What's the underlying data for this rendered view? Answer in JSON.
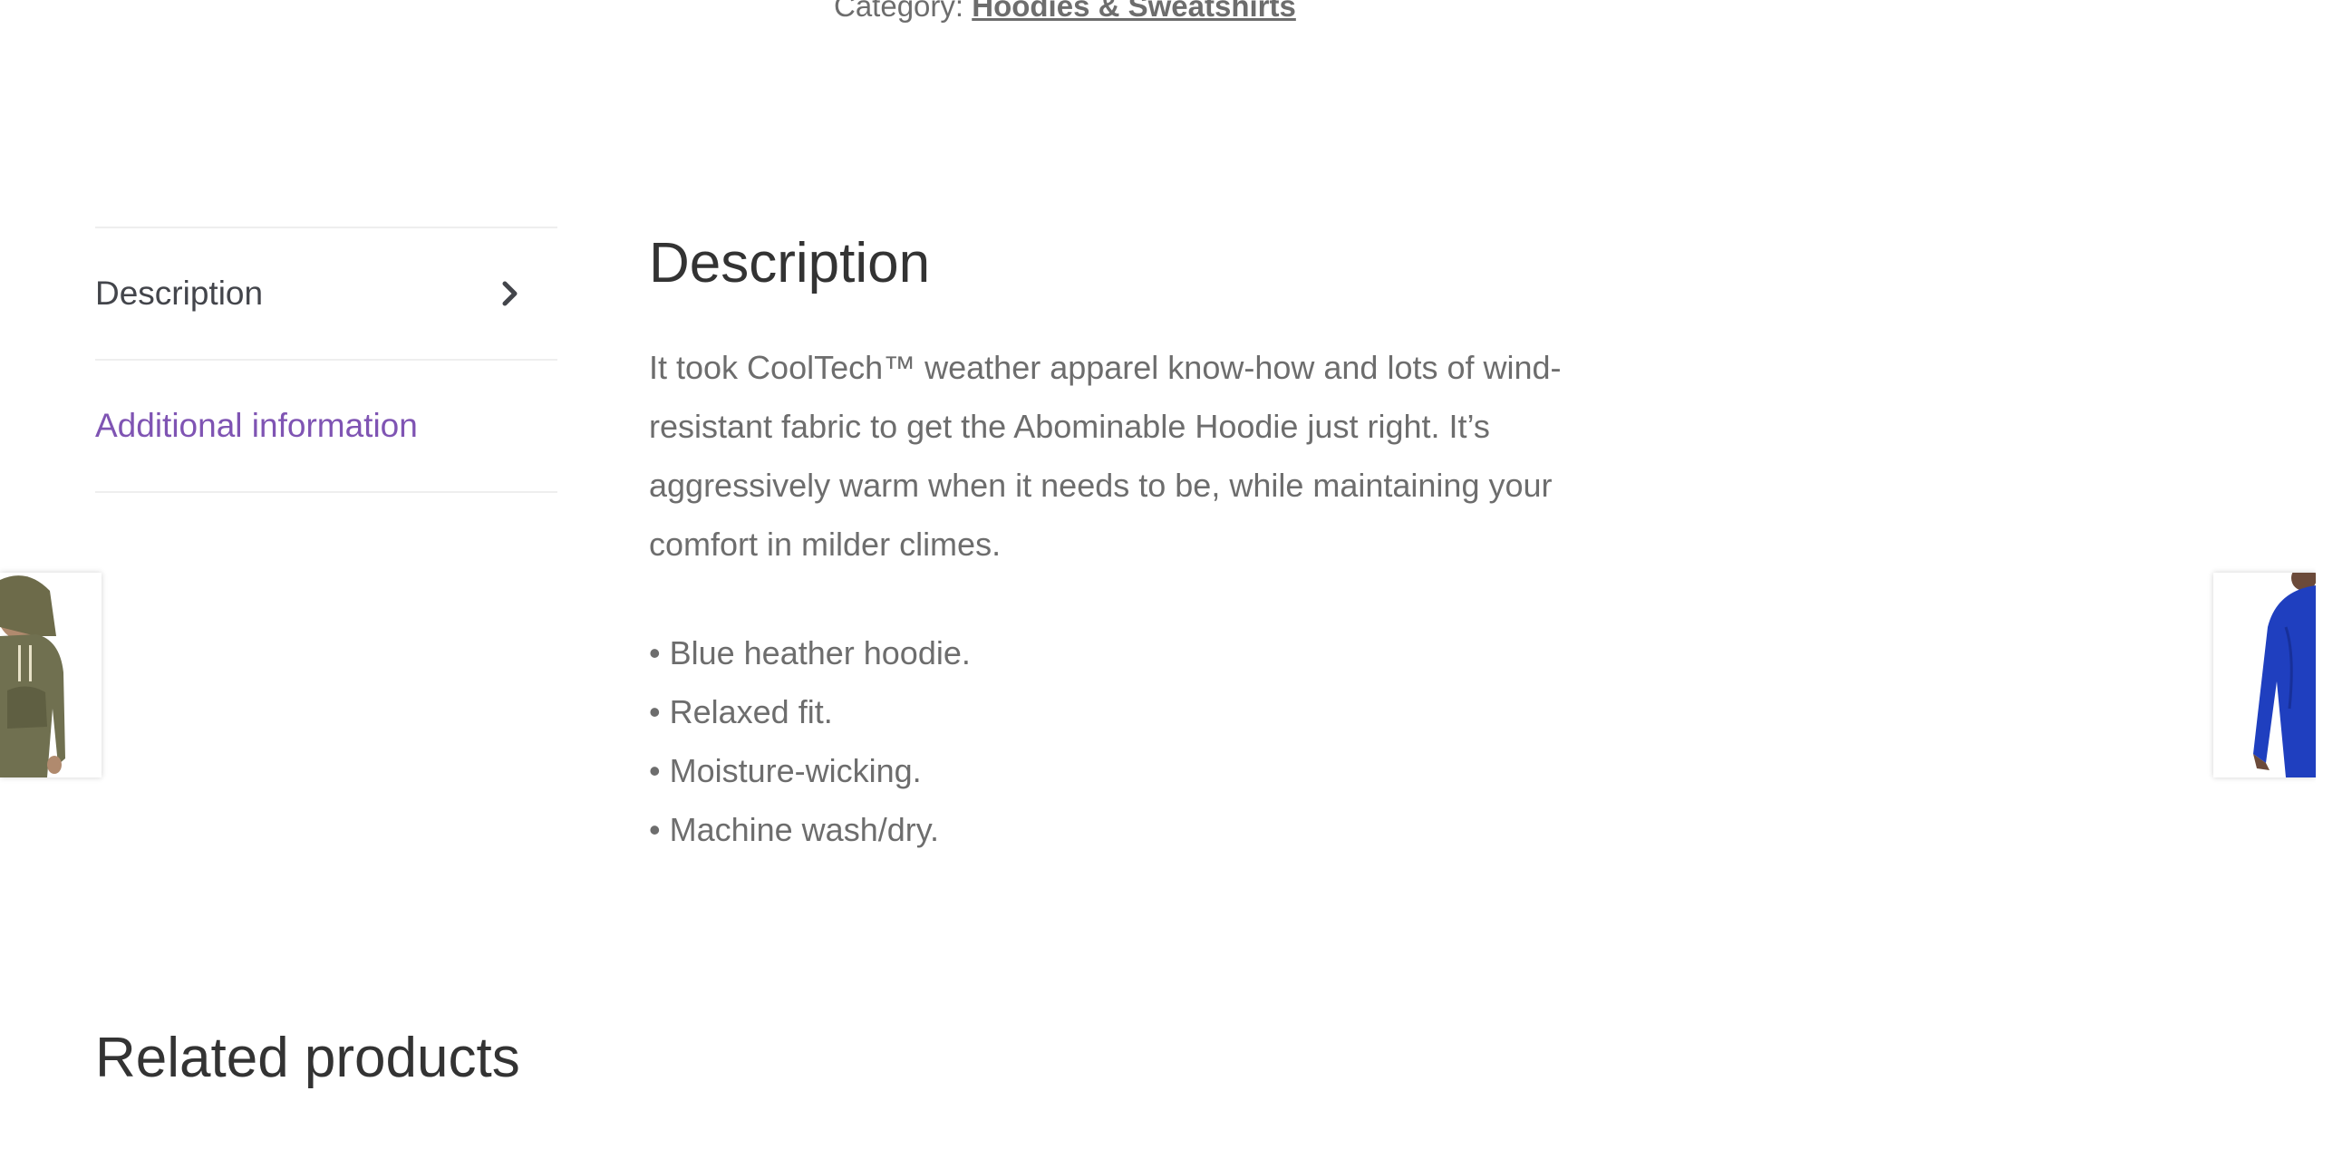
{
  "product_meta": {
    "category_label": "Category:",
    "category_link": "Hoodies & Sweatshirts"
  },
  "tabs": [
    {
      "label": "Description"
    },
    {
      "label": "Additional information"
    }
  ],
  "description": {
    "heading": "Description",
    "text": "It took CoolTech™ weather apparel know-how and lots of wind-resistant fabric to get the Abominable Hoodie just right. It’s aggressively warm when it needs to be, while maintaining your comfort in milder climes.",
    "bullets": [
      "• Blue heather hoodie.",
      "• Relaxed fit.",
      "• Moisture-wicking.",
      "• Machine wash/dry."
    ]
  },
  "related": {
    "heading": "Related products"
  },
  "colors": {
    "accent_link": "#7f54b3",
    "text": "#6d6d6d",
    "heading": "#333333"
  },
  "icons": {
    "tab_chevron": "chevron-right-icon",
    "scroll_up": "arrow-up-icon",
    "scroll_down": "arrow-down-icon"
  }
}
